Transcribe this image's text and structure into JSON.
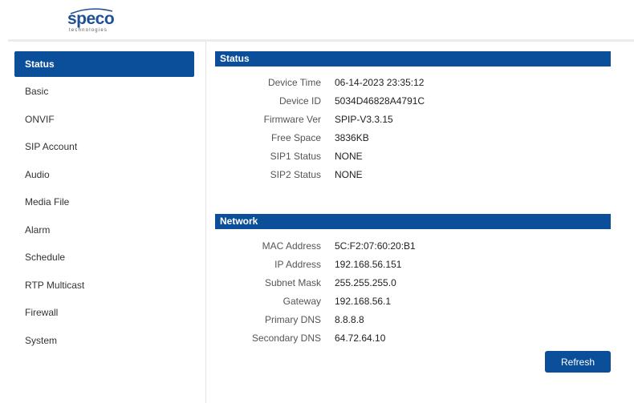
{
  "brand": {
    "name": "speco",
    "tagline": "technologies"
  },
  "nav": {
    "items": [
      {
        "label": "Status",
        "active": true
      },
      {
        "label": "Basic"
      },
      {
        "label": "ONVIF"
      },
      {
        "label": "SIP Account"
      },
      {
        "label": "Audio"
      },
      {
        "label": "Media File"
      },
      {
        "label": "Alarm"
      },
      {
        "label": "Schedule"
      },
      {
        "label": "RTP Multicast"
      },
      {
        "label": "Firewall"
      },
      {
        "label": "System"
      }
    ]
  },
  "status": {
    "title": "Status",
    "rows": [
      {
        "label": "Device Time",
        "value": "06-14-2023 23:35:12"
      },
      {
        "label": "Device ID",
        "value": "5034D46828A4791C"
      },
      {
        "label": "Firmware Ver",
        "value": "SPIP-V3.3.15"
      },
      {
        "label": "Free Space",
        "value": "3836KB"
      },
      {
        "label": "SIP1 Status",
        "value": "NONE"
      },
      {
        "label": "SIP2 Status",
        "value": "NONE"
      }
    ]
  },
  "network": {
    "title": "Network",
    "rows": [
      {
        "label": "MAC Address",
        "value": "5C:F2:07:60:20:B1"
      },
      {
        "label": "IP Address",
        "value": "192.168.56.151"
      },
      {
        "label": "Subnet Mask",
        "value": "255.255.255.0"
      },
      {
        "label": "Gateway",
        "value": "192.168.56.1"
      },
      {
        "label": "Primary DNS",
        "value": "8.8.8.8"
      },
      {
        "label": "Secondary DNS",
        "value": "64.72.64.10"
      }
    ]
  },
  "actions": {
    "refresh_label": "Refresh"
  },
  "colors": {
    "accent": "#0b4f9a",
    "brand": "#1f4f95"
  }
}
